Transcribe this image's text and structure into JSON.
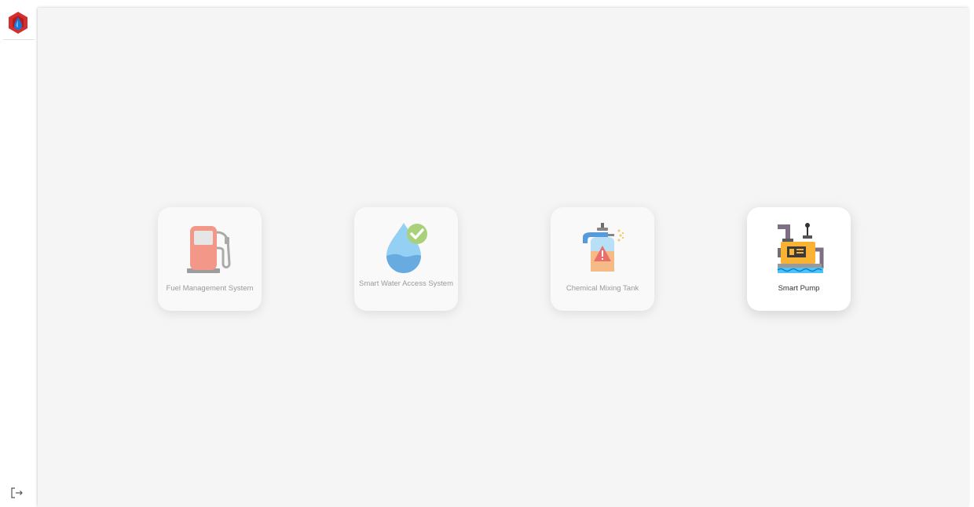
{
  "sidebar": {
    "logo_icon": "company-logo-icon",
    "logout_icon": "logout-icon"
  },
  "apps": [
    {
      "label": "Fuel Management System",
      "icon": "fuel-pump-icon",
      "active": false
    },
    {
      "label": "Smart Water Access System",
      "icon": "water-drop-check-icon",
      "active": false
    },
    {
      "label": "Chemical Mixing Tank",
      "icon": "chemical-tank-icon",
      "active": false
    },
    {
      "label": "Smart Pump",
      "icon": "smart-pump-icon",
      "active": true
    }
  ],
  "colors": {
    "background": "#f5f5f5",
    "logo_red": "#d32f2f",
    "logo_blue": "#1565c0",
    "active_text": "#333333",
    "inactive_text": "#9a9a9a"
  }
}
